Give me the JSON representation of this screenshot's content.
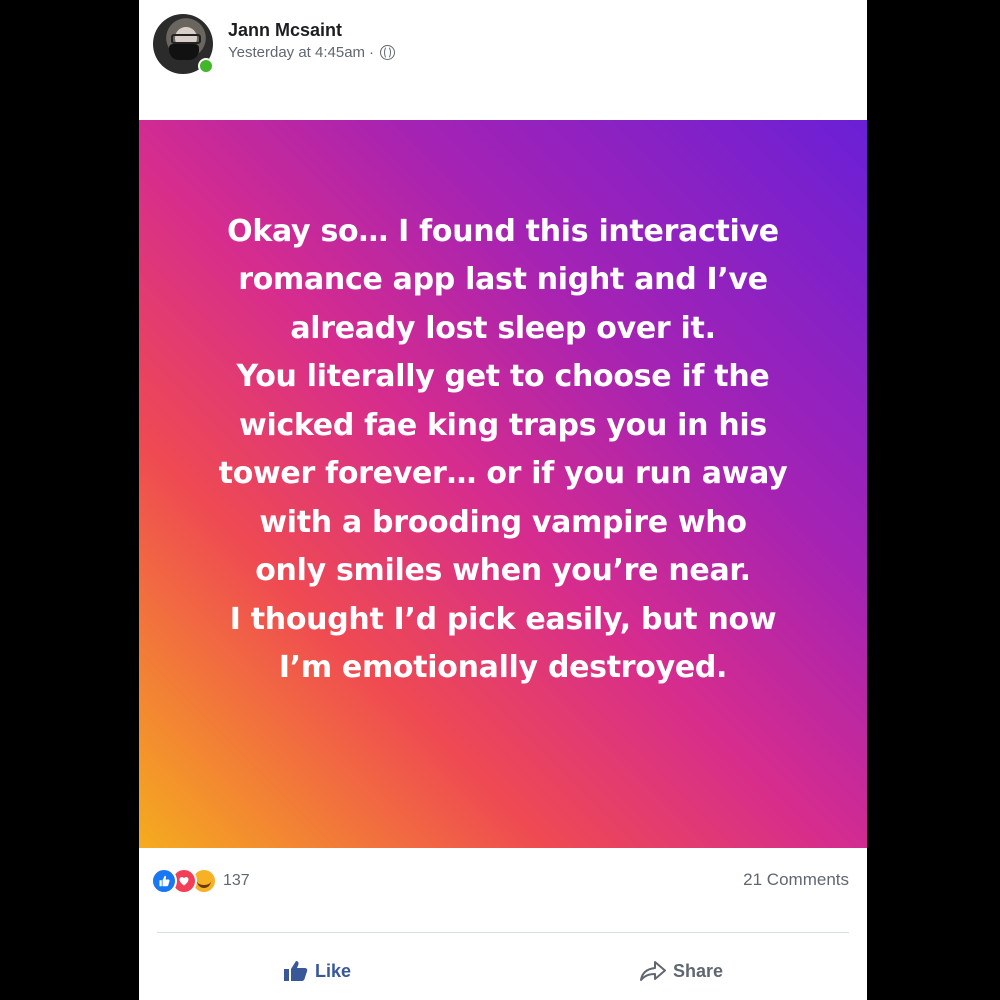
{
  "post": {
    "author": "Jann Mcsaint",
    "timestamp": "Yesterday at 4:45am",
    "separator": "·",
    "privacy_icon": "globe-icon",
    "lines": [
      "Okay so… I found this interactive",
      "romance app last night and I’ve",
      "already lost sleep over it.",
      "You literally get to choose if the",
      "wicked fae king traps you in his",
      "tower forever… or if you run away",
      "with a brooding vampire who",
      "only smiles when you’re near.",
      "I thought I’d pick easily, but now",
      "I’m emotionally destroyed."
    ],
    "background_colors": [
      "#f5ac1e",
      "#ef4a52",
      "#d62c8e",
      "#a523b3",
      "#6a20d6"
    ]
  },
  "engagement": {
    "reaction_icons": [
      "like-icon",
      "love-icon",
      "haha-icon"
    ],
    "reaction_count": "137",
    "comments": "21 Comments"
  },
  "actions": {
    "like": "Like",
    "share": "Share"
  },
  "colors": {
    "like_blue": "#385898",
    "online": "#42b72a"
  }
}
